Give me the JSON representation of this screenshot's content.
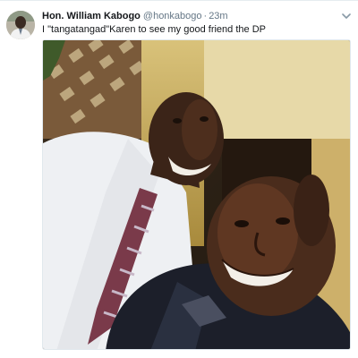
{
  "tweet": {
    "author": {
      "fullname": "Hon. William Kabogo",
      "username": "@honkabogo",
      "avatar_icon": "profile-avatar"
    },
    "separator": "·",
    "timestamp": "23m",
    "text": "I \"tangatangad\"Karen to see my good friend the DP",
    "menu_icon": "chevron-down-icon",
    "media": {
      "type": "photo",
      "icon": "photo"
    }
  },
  "colors": {
    "name": "#14171a",
    "secondary": "#657786",
    "border": "#e1e8ed"
  }
}
